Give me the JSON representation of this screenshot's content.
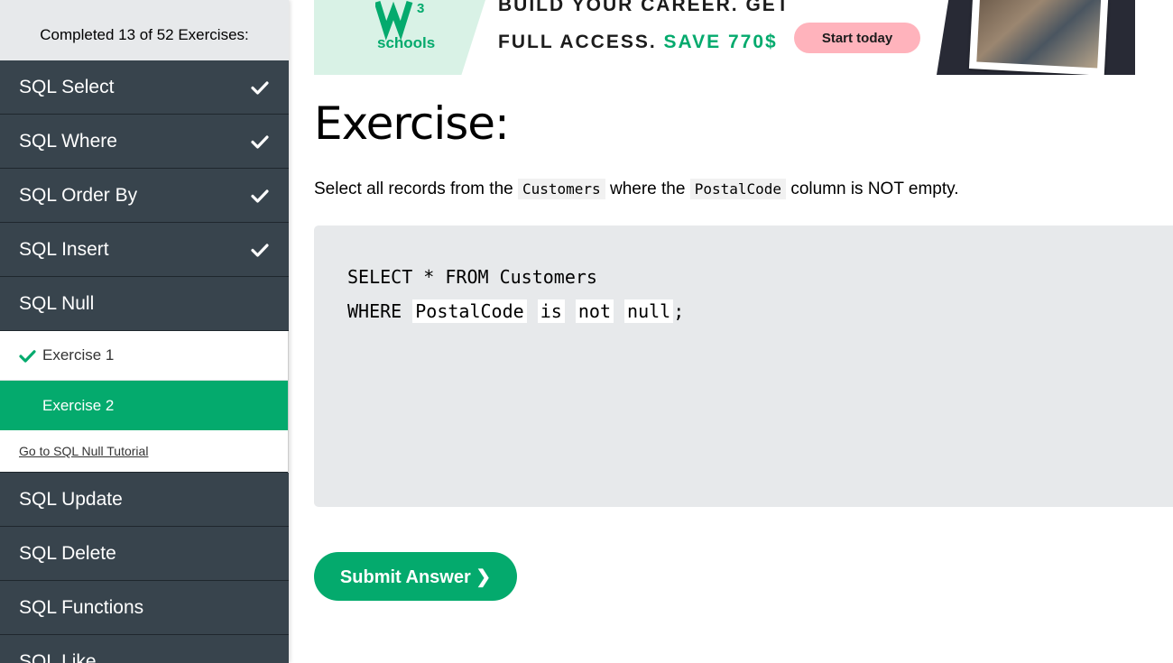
{
  "sidebar": {
    "progress_text": "Completed 13 of 52 Exercises:",
    "chapters_before": [
      {
        "label": "SQL Select",
        "completed": true
      },
      {
        "label": "SQL Where",
        "completed": true
      },
      {
        "label": "SQL Order By",
        "completed": true
      },
      {
        "label": "SQL Insert",
        "completed": true
      },
      {
        "label": "SQL Null",
        "completed": false
      }
    ],
    "exercises": [
      {
        "label": "Exercise 1",
        "completed": true
      },
      {
        "label": "Exercise 2",
        "completed": false,
        "current": true
      }
    ],
    "tutorial_link": "Go to SQL Null Tutorial",
    "chapters_after": [
      {
        "label": "SQL Update"
      },
      {
        "label": "SQL Delete"
      },
      {
        "label": "SQL Functions"
      },
      {
        "label": "SQL Like"
      }
    ]
  },
  "banner": {
    "logo_text": "schools",
    "logo_superscript": "3",
    "line1": "BUILD YOUR CAREER. GET",
    "line2_prefix": "FULL ACCESS.",
    "line2_highlight": "SAVE 770$",
    "cta_label": "Start today"
  },
  "main": {
    "title": "Exercise:",
    "instruction_parts": [
      "Select all records from the",
      "Customers",
      "where the",
      "PostalCode",
      "column is NOT empty."
    ],
    "code_line1": "SELECT * FROM Customers",
    "code_line2_keyword": "WHERE",
    "answers": [
      "PostalCode",
      "is",
      "not",
      "null"
    ],
    "code_terminator": ";",
    "submit_label": "Submit Answer ❯"
  },
  "colors": {
    "sidebar_bg": "#38444d",
    "accent_green": "#04aa6d",
    "code_bg": "#e7e9eb",
    "banner_cta": "#ffb3bc"
  }
}
